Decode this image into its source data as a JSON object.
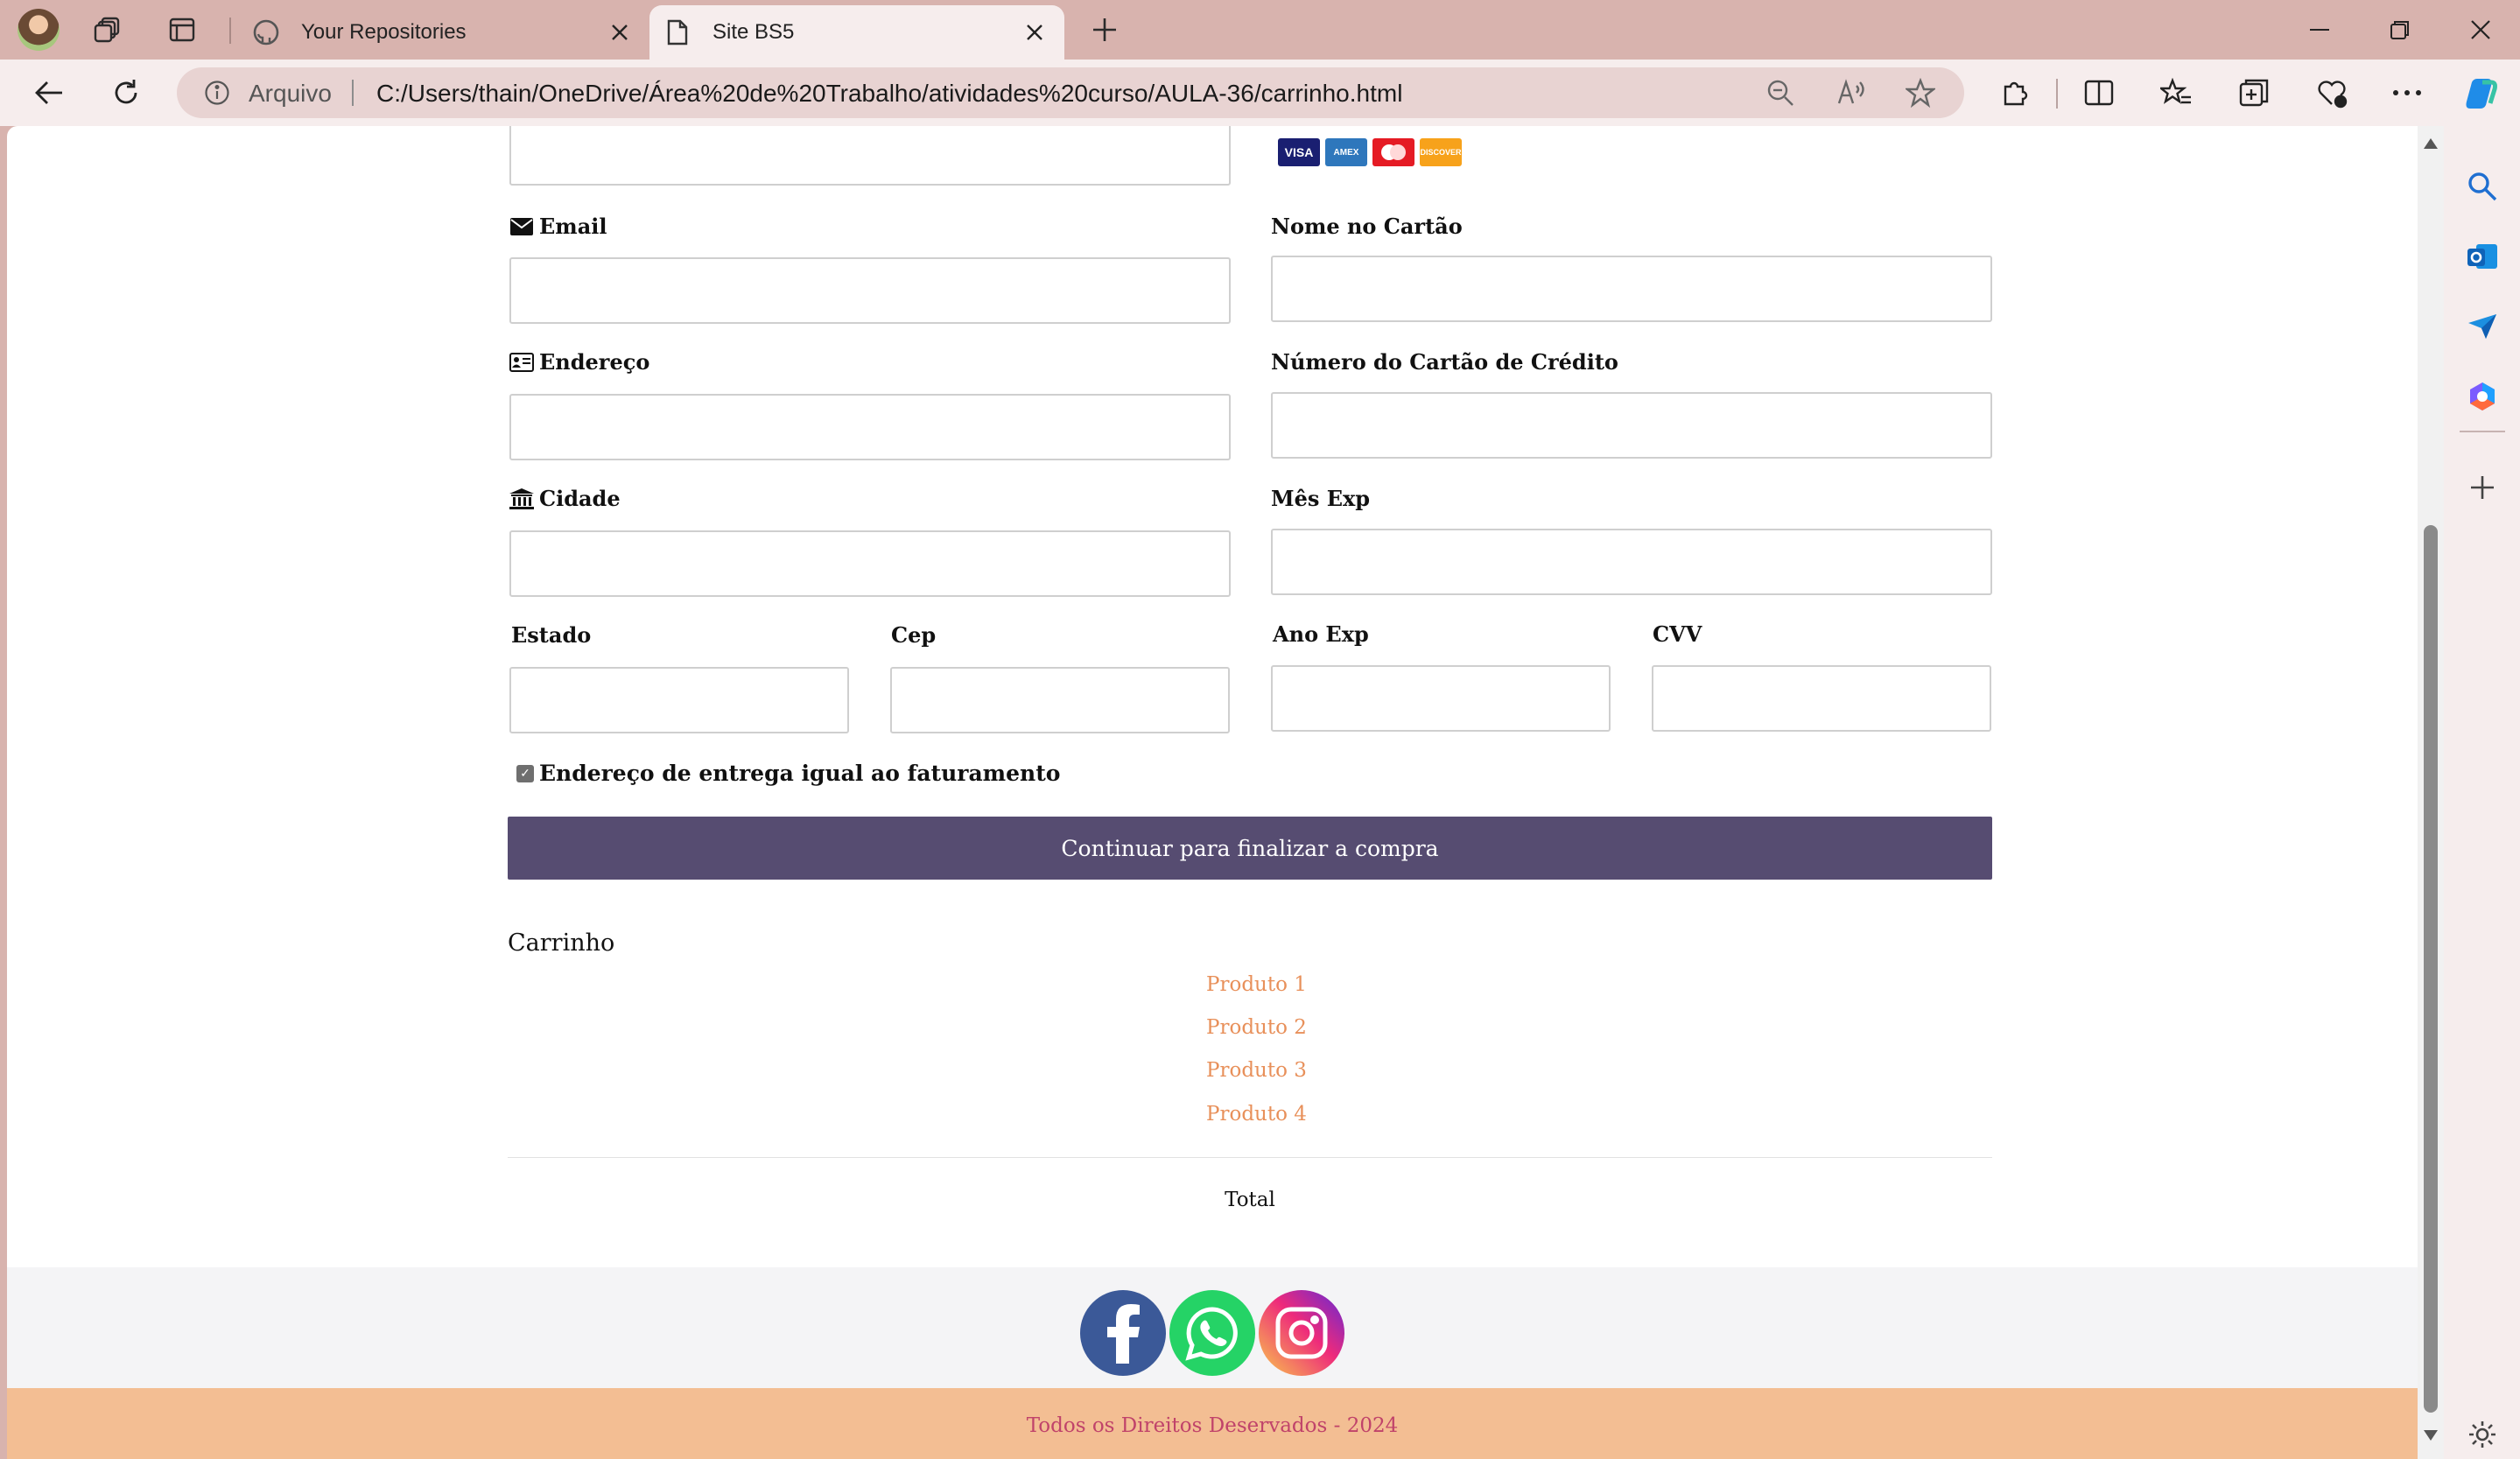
{
  "browser": {
    "tabs": [
      {
        "title": "Your Repositories",
        "icon": "github-icon",
        "active": false
      },
      {
        "title": "Site BS5",
        "icon": "page-icon",
        "active": true
      }
    ],
    "address": {
      "security_label": "Arquivo",
      "url": "C:/Users/thain/OneDrive/Área%20de%20Trabalho/atividades%20curso/AULA-36/carrinho.html"
    }
  },
  "form": {
    "email_label": "Email",
    "address_label": "Endereço",
    "city_label": "Cidade",
    "state_label": "Estado",
    "zip_label": "Cep",
    "card_name_label": "Nome no Cartão",
    "card_number_label": "Número do Cartão de Crédito",
    "exp_month_label": "Mês Exp",
    "exp_year_label": "Ano Exp",
    "cvv_label": "CVV",
    "same_address_label": "Endereço de entrega igual ao faturamento",
    "same_address_checked": true,
    "submit_label": "Continuar para finalizar a compra",
    "accepted_cards": [
      "VISA",
      "AMEX",
      "MC",
      "DISCOVER"
    ]
  },
  "cart": {
    "title": "Carrinho",
    "items": [
      "Produto 1",
      "Produto 2",
      "Produto 3",
      "Produto 4"
    ],
    "total_label": "Total"
  },
  "footer": {
    "social": [
      "facebook-icon",
      "whatsapp-icon",
      "instagram-icon"
    ],
    "copyright": "Todos os Direitos Deservados - 2024"
  },
  "colors": {
    "button": "#564c71",
    "cart_link": "#e8905a",
    "footer_bg": "#f3be93",
    "footer_text": "#c0436a",
    "chrome": "#d8b3ae"
  }
}
